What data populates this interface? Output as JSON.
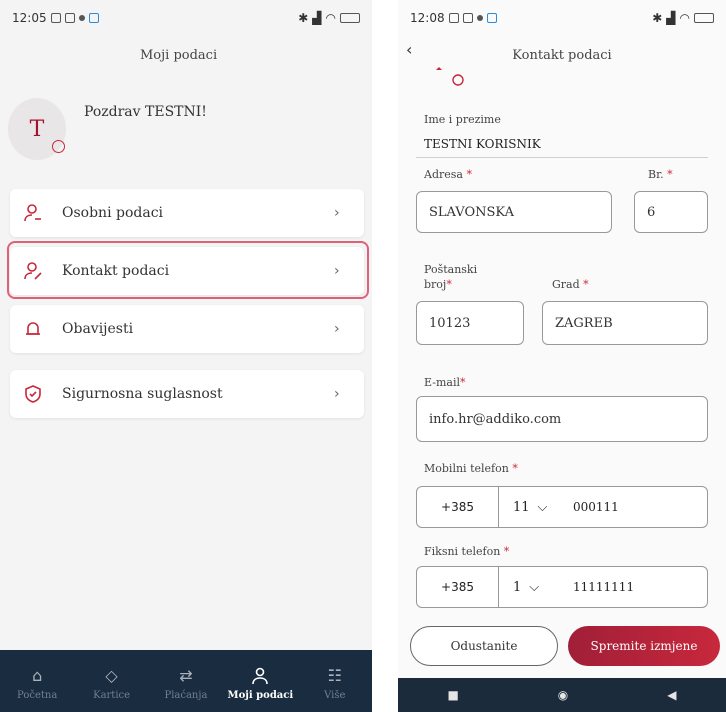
{
  "left": {
    "status_time": "12:05",
    "header_title": "Moji podaci",
    "avatar_letter": "T",
    "greeting": "Pozdrav TESTNI!",
    "menu": [
      {
        "label": "Osobni podaci",
        "icon": "person-icon"
      },
      {
        "label": "Kontakt podaci",
        "icon": "person-edit-icon"
      },
      {
        "label": "Obavijesti",
        "icon": "bell-icon"
      },
      {
        "label": "Sigurnosna suglasnost",
        "icon": "shield-icon"
      }
    ],
    "nav": [
      {
        "label": "Početna",
        "icon": "home-icon"
      },
      {
        "label": "Kartice",
        "icon": "card-icon"
      },
      {
        "label": "Plaćanja",
        "icon": "transfer-icon"
      },
      {
        "label": "Moji podaci",
        "icon": "user-icon",
        "active": true
      },
      {
        "label": "Više",
        "icon": "more-icon"
      }
    ]
  },
  "right": {
    "status_time": "12:08",
    "header_title": "Kontakt podaci",
    "name_label": "Ime i prezime",
    "name_value": "TESTNI KORISNIK",
    "address_label": "Adresa",
    "address_value": "SLAVONSKA",
    "number_label": "Br.",
    "number_value": "6",
    "postal_label_1": "Poštanski",
    "postal_label_2": "broj",
    "postal_value": "10123",
    "city_label": "Grad",
    "city_value": "ZAGREB",
    "email_label": "E-mail",
    "email_value": "info.hr@addiko.com",
    "mobile_label": "Mobilni telefon",
    "mobile_cc": "+385",
    "mobile_area": "11",
    "mobile_number": "000111",
    "fixed_label": "Fiksni telefon",
    "fixed_cc": "+385",
    "fixed_area": "1",
    "fixed_number": "11111111",
    "required_mark": "*",
    "cancel_label": "Odustanite",
    "save_label": "Spremite izmjene"
  },
  "colors": {
    "accent": "#c8283c",
    "nav_bg": "#1a2c3f",
    "highlight": "#e0607a"
  }
}
